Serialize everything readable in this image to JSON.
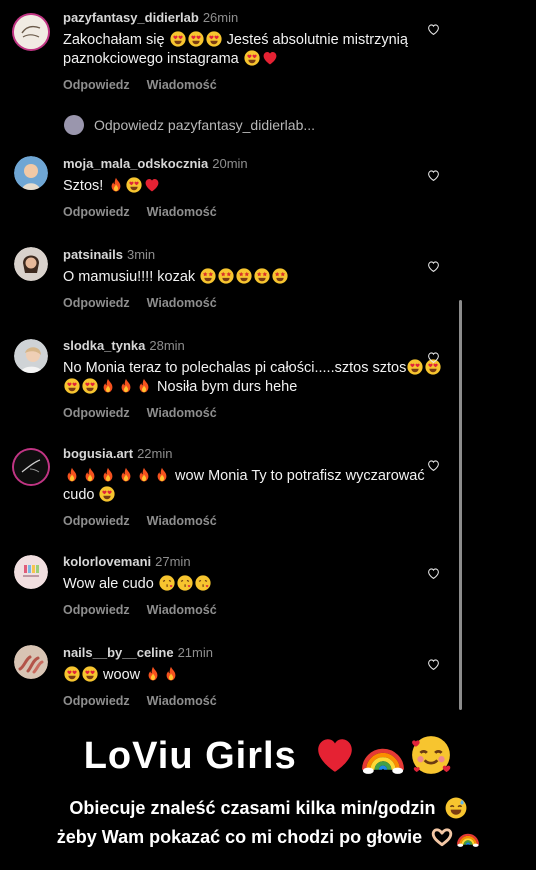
{
  "comments": [
    {
      "user": "pazyfantasy_didierlab",
      "time": "26min",
      "text_before": "Zakochałam się",
      "text_after": "Jesteś absolutnie mistrzynią paznokciowego instagrama",
      "reply": "Odpowiedz",
      "message": "Wiadomość"
    },
    {
      "user": "moja_mala_odskocznia",
      "time": "20min",
      "text": "Sztos!",
      "reply": "Odpowiedz",
      "message": "Wiadomość"
    },
    {
      "user": "patsinails",
      "time": "3min",
      "text": "O mamusiu!!!! kozak",
      "reply": "Odpowiedz",
      "message": "Wiadomość"
    },
    {
      "user": "slodka_tynka",
      "time": "28min",
      "text_before": "No Monia teraz to polechalas pi całości.....sztos sztos",
      "text_after": "Nosiła bym durs hehe",
      "reply": "Odpowiedz",
      "message": "Wiadomość"
    },
    {
      "user": "bogusia.art",
      "time": "22min",
      "text_before": "wow Monia Ty to potrafisz wyczarować cudo",
      "reply": "Odpowiedz",
      "message": "Wiadomość"
    },
    {
      "user": "kolorlovemani",
      "time": "27min",
      "text": "Wow ale cudo",
      "reply": "Odpowiedz",
      "message": "Wiadomość"
    },
    {
      "user": "nails__by__celine",
      "time": "21min",
      "text": "woow",
      "reply": "Odpowiedz",
      "message": "Wiadomość"
    }
  ],
  "view_replies": "Odpowiedz pazyfantasy_didierlab...",
  "overlay": {
    "title": "LoViu Girls",
    "line1": "Obiecuje znaleść czasami kilka min/godzin",
    "line2": "żeby Wam pokazać co mi chodzi po głowie"
  },
  "colors": {
    "background": "#000000",
    "muted": "#8e8e8e",
    "story_ring": "#c13584"
  }
}
